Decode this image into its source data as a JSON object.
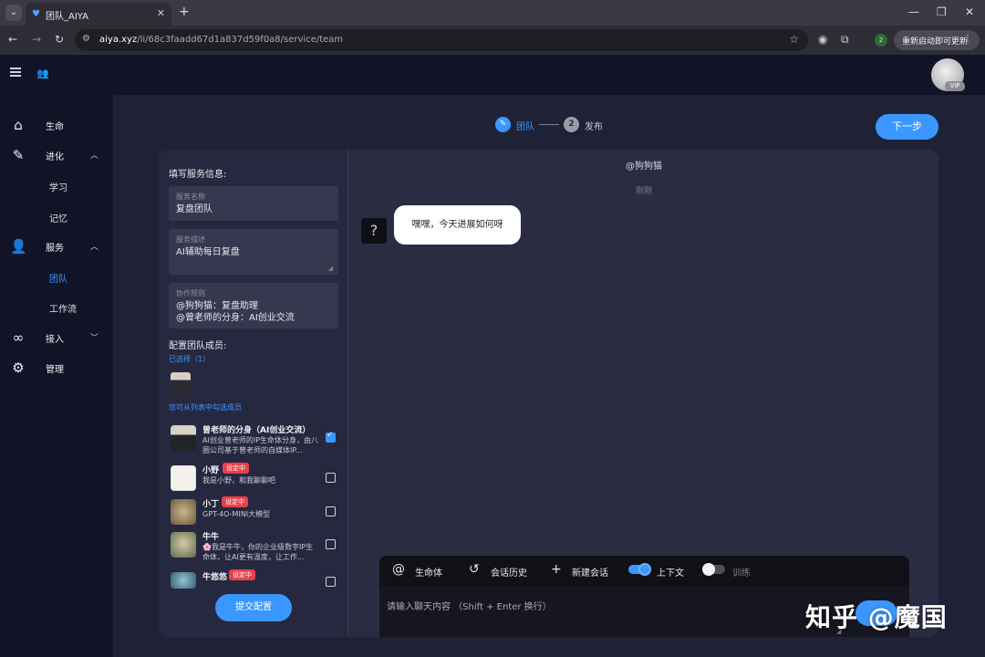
{
  "browser": {
    "tab_title": "团队_AIYA",
    "url_host": "aiya.xyz",
    "url_path": "/li/68c3faadd67d1a837d59f0a8/service/team",
    "update_label": "重新启动即可更新",
    "extension_badge": "2"
  },
  "header": {
    "vip_label": "VIP"
  },
  "sidebar": {
    "items": [
      {
        "label": "生命"
      },
      {
        "label": "进化"
      },
      {
        "label": "学习"
      },
      {
        "label": "记忆"
      },
      {
        "label": "服务"
      },
      {
        "label": "团队"
      },
      {
        "label": "工作流"
      },
      {
        "label": "接入"
      },
      {
        "label": "管理"
      }
    ]
  },
  "steps": [
    {
      "number": "1",
      "label": "团队",
      "active": true
    },
    {
      "number": "2",
      "label": "发布",
      "active": false
    }
  ],
  "next_label": "下一步",
  "form": {
    "section_title": "填写服务信息:",
    "name_label": "服务名称",
    "name_value": "复盘团队",
    "desc_label": "服务描述",
    "desc_value": "AI辅助每日复盘",
    "rules_label": "协作规则",
    "rules_line1": "@狗狗猫：复盘助理",
    "rules_line2": "@曾老师的分身：AI创业交流"
  },
  "members": {
    "section_title": "配置团队成员:",
    "selected_count": "已选择（1）",
    "hint": "您可从列表中勾选成员",
    "list": [
      {
        "name": "曾老师的分身（AI创业交流）",
        "desc": "AI创业曾老师的IP生命体分身，由八圈公司基于曾老师的自媒体IP...",
        "badge": "",
        "checked": true
      },
      {
        "name": "小野",
        "desc": "我是小野，和我聊聊吧",
        "badge": "设定中",
        "checked": false
      },
      {
        "name": "小丁",
        "desc": "GPT-4O-MINI大模型",
        "badge": "设定中",
        "checked": false
      },
      {
        "name": "牛牛",
        "desc": "🌸我是牛牛，你的企业级数字IP生命体，让AI更有温度，让工作...",
        "badge": "",
        "checked": false
      },
      {
        "name": "牛悠悠",
        "desc": "",
        "badge": "设定中",
        "checked": false
      }
    ],
    "submit_label": "提交配置"
  },
  "chat": {
    "title": "@狗狗猫",
    "time": "刚刚",
    "message": "嘿嘿，今天进展如何呀",
    "toolbar": {
      "life": "生命体",
      "history": "会话历史",
      "new_chat": "新建会话",
      "context": "上下文",
      "train": "训练"
    },
    "placeholder": "请输入聊天内容 （Shift + Enter 换行）"
  },
  "watermark": "知乎 @魔国",
  "colors": {
    "accent": "#3a97ff",
    "badge": "#e9414b",
    "sidebar_bg": "#111426",
    "panel_bg": "#2a2c42"
  }
}
